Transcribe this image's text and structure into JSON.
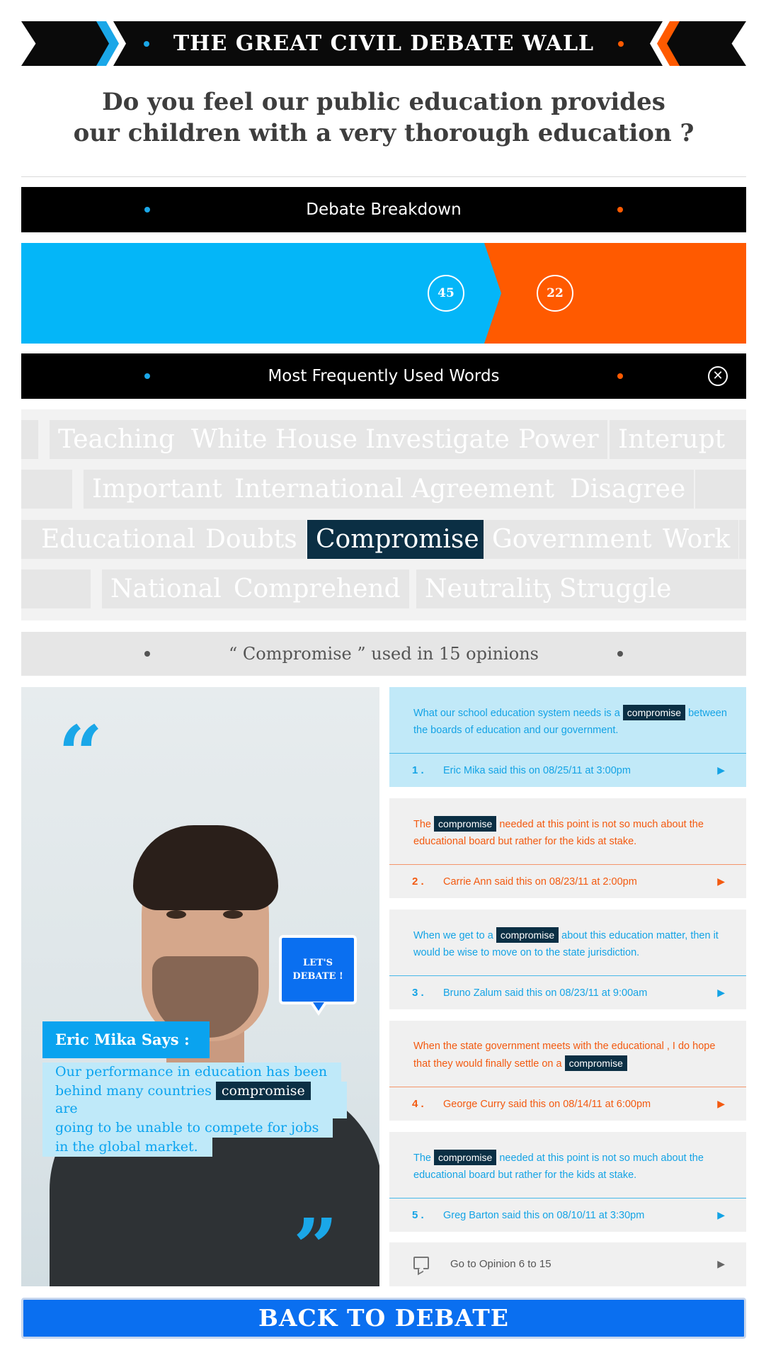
{
  "header": {
    "title": "THE GREAT CIVIL DEBATE WALL"
  },
  "question": {
    "line1": "Do you feel our public education provides",
    "line2": "our children with a very thorough education ?"
  },
  "breakdown": {
    "label": "Debate Breakdown",
    "blue_count": "45",
    "orange_count": "22",
    "blue_value": 45,
    "orange_value": 22
  },
  "words_section": {
    "label": "Most Frequently Used Words"
  },
  "word_cloud": {
    "row1": [
      "Teaching",
      "White House",
      "Investigate",
      "Power",
      "Interupt"
    ],
    "row2": [
      "Important",
      "International",
      "Agreement",
      "Disagree"
    ],
    "row3": [
      "Educational",
      "Doubts",
      "Compromise",
      "Government",
      "Work"
    ],
    "row4": [
      "National",
      "Comprehend",
      "Neutrality",
      "Struggle"
    ],
    "selected": "Compromise"
  },
  "usage": {
    "label": "“ Compromise ” used in 15 opinions"
  },
  "featured": {
    "speaker": "Eric Mika Says :",
    "line1": "Our performance in education has been",
    "line2_pre": "behind many countries",
    "keyword": "compromise",
    "line2_post": "are",
    "line3": "going to be unable to compete for jobs",
    "line4": "in the global market.",
    "cta_line1": "LET'S",
    "cta_line2": "DEBATE !"
  },
  "opinions": [
    {
      "num": "1 .",
      "pre": "What our school education system needs is a",
      "keyword": "compromise",
      "post": "between the boards of education and our government.",
      "by": "Eric Mika said this on 08/25/11 at 3:00pm",
      "color": "#14a3e5"
    },
    {
      "num": "2 .",
      "pre": "The",
      "keyword": "compromise",
      "post": "needed at this point is not so much about the educational board but rather for the kids at stake.",
      "by": "Carrie Ann said this on 08/23/11 at 2:00pm",
      "color": "#f35a10"
    },
    {
      "num": "3 .",
      "pre": "When we get to a",
      "keyword": "compromise",
      "post": "about this education matter, then it would be wise to move on to the state jurisdiction.",
      "by": "Bruno Zalum said this on 08/23/11 at 9:00am",
      "color": "#14a3e5"
    },
    {
      "num": "4 .",
      "pre": "When the state government meets with the educational , I do hope that they would finally settle on a",
      "keyword": "compromise",
      "post": "",
      "by": "George Curry said this on 08/14/11 at 6:00pm",
      "color": "#f35a10"
    },
    {
      "num": "5 .",
      "pre": "The",
      "keyword": "compromise",
      "post": "needed at this point is not so much about the educational board but rather for the kids at stake.",
      "by": "Greg Barton said this on 08/10/11 at 3:30pm",
      "color": "#14a3e5"
    }
  ],
  "more": {
    "label": "Go to Opinion 6 to 15"
  },
  "back_button": {
    "label": "BACK TO DEBATE"
  },
  "colors": {
    "blue": "#04b6f8",
    "orange": "#ff5a00",
    "navy": "#0b2f44",
    "button_blue": "#0a6ff0"
  },
  "icons": {
    "close": "close-icon",
    "play": "play-icon",
    "chat": "chat-icon",
    "quote": "quote-icon"
  }
}
